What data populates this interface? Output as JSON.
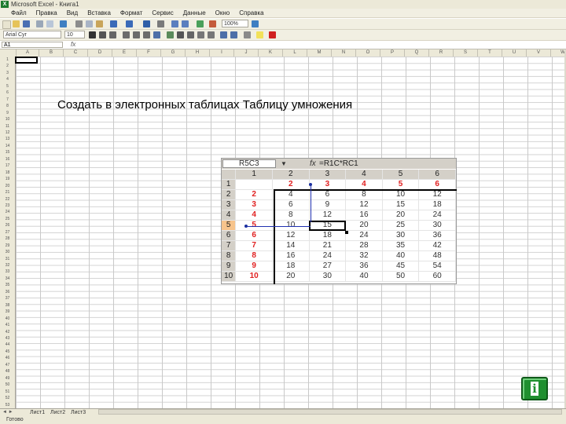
{
  "window": {
    "title": "Microsoft Excel - Книга1"
  },
  "menu": [
    "Файл",
    "Правка",
    "Вид",
    "Вставка",
    "Формат",
    "Сервис",
    "Данные",
    "Окно",
    "Справка"
  ],
  "toolbar": {
    "zoom": "100%",
    "font_name": "Arial Cyr",
    "font_size": "10"
  },
  "formula_bar": {
    "cell_ref": "A1"
  },
  "columns": [
    "A",
    "B",
    "C",
    "D",
    "E",
    "F",
    "G",
    "H",
    "I",
    "J",
    "K",
    "L",
    "M",
    "N",
    "O",
    "P",
    "Q",
    "R",
    "S",
    "T",
    "U",
    "V",
    "W"
  ],
  "sheet_tabs": [
    "Лист1",
    "Лист2",
    "Лист3"
  ],
  "status": "Готово",
  "heading": "Создать в электронных таблицах Таблицу умножения",
  "inset": {
    "name_box": "R5C3",
    "fx": "fx",
    "formula": "=R1C*RC1",
    "column_headers": [
      "1",
      "2",
      "3",
      "4",
      "5",
      "6"
    ],
    "rows": [
      {
        "row_header": "1",
        "cells": [
          "",
          "2",
          "3",
          "4",
          "5",
          "6"
        ]
      },
      {
        "row_header": "2",
        "cells": [
          "2",
          "4",
          "6",
          "8",
          "10",
          "12"
        ]
      },
      {
        "row_header": "3",
        "cells": [
          "3",
          "6",
          "9",
          "12",
          "15",
          "18"
        ]
      },
      {
        "row_header": "4",
        "cells": [
          "4",
          "8",
          "12",
          "16",
          "20",
          "24"
        ]
      },
      {
        "row_header": "5",
        "cells": [
          "5",
          "10",
          "15",
          "20",
          "25",
          "30"
        ]
      },
      {
        "row_header": "6",
        "cells": [
          "6",
          "12",
          "18",
          "24",
          "30",
          "36"
        ]
      },
      {
        "row_header": "7",
        "cells": [
          "7",
          "14",
          "21",
          "28",
          "35",
          "42"
        ]
      },
      {
        "row_header": "8",
        "cells": [
          "8",
          "16",
          "24",
          "32",
          "40",
          "48"
        ]
      },
      {
        "row_header": "9",
        "cells": [
          "9",
          "18",
          "27",
          "36",
          "45",
          "54"
        ]
      },
      {
        "row_header": "10",
        "cells": [
          "10",
          "20",
          "30",
          "40",
          "50",
          "60"
        ]
      }
    ],
    "highlight_color": "#f7c48c",
    "factor_color": "#e02020"
  },
  "info_button": {
    "icon": "info-icon",
    "glyph": "i",
    "color": "#1f8f2f"
  }
}
